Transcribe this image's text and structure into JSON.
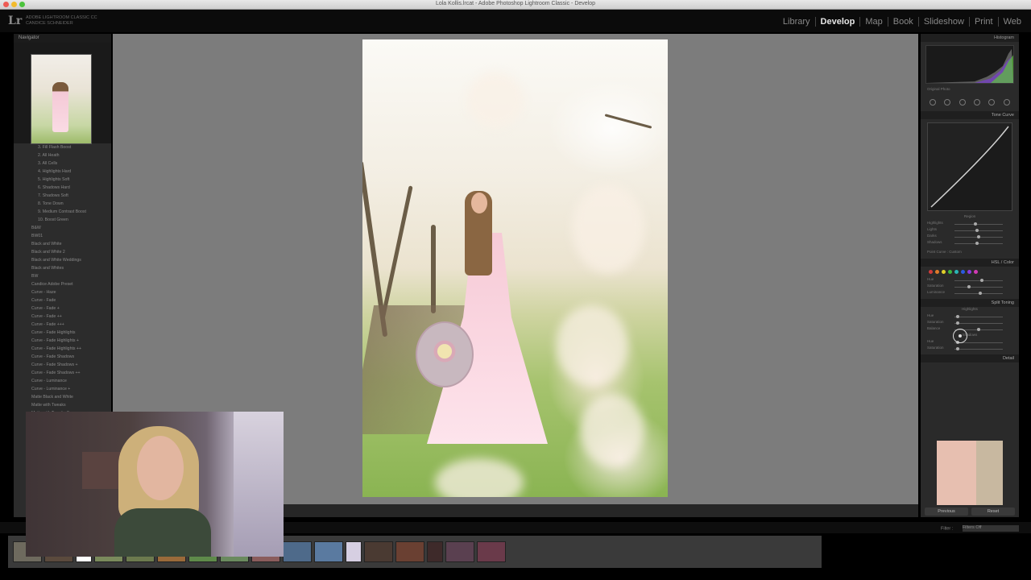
{
  "window": {
    "title": "Lola Kollis.lrcat - Adobe Photoshop Lightroom Classic - Develop"
  },
  "header": {
    "logo": "Lr",
    "brand_line1": "ADOBE LIGHTROOM CLASSIC CC",
    "brand_line2": "CANDICE SCHNEIDER",
    "modules": [
      "Library",
      "Develop",
      "Map",
      "Book",
      "Slideshow",
      "Print",
      "Web"
    ],
    "active_module": "Develop"
  },
  "left_panel": {
    "navigator_title": "Navigator",
    "presets": [
      "3. Fill Flash Boost",
      "2. All Heath",
      "3. All Cells",
      "4. Highlights Hard",
      "5. Highlights Soft",
      "6. Shadows Hard",
      "7. Shadows Soft",
      "8. Tone Down",
      "9. Medium Contrast Boost",
      "10. Boost Green",
      "B&W",
      "BW01",
      "Black and White",
      "Black and White 2",
      "Black and White Weddings",
      "Black and Whites",
      "BW",
      "Candice Adobe Preset",
      "Curve - Haze",
      "Curve - Fade",
      "Curve - Fade +",
      "Curve - Fade ++",
      "Curve - Fade +++",
      "Curve - Fade Highlights",
      "Curve - Fade Highlights +",
      "Curve - Fade Highlights ++",
      "Curve - Fade Shadows",
      "Curve - Fade Shadows +",
      "Curve - Fade Shadows ++",
      "Curve - Luminance",
      "Curve - Luminance +",
      "Matte Black and White",
      "Matte with Tweaks",
      "Matte with Tweaks 2"
    ]
  },
  "right_panel": {
    "histogram_title": "Histogram",
    "original_photo": "Original Photo",
    "tone_curve_title": "Tone Curve",
    "region_label": "Region",
    "curve_sliders": [
      "Highlights",
      "Lights",
      "Darks",
      "Shadows"
    ],
    "point_curve_label": "Point Curve :",
    "point_curve_value": "Custom",
    "hsl_title": "HSL / Color",
    "hsl_sliders": [
      "Hue",
      "Saturation",
      "Luminance"
    ],
    "split_toning_title": "Split Toning",
    "highlights_label": "Highlights",
    "balance_label": "Balance",
    "shadows_label": "Shadows",
    "hue_label": "Hue",
    "saturation_label": "Saturation",
    "detail_title": "Detail",
    "previous_button": "Previous",
    "reset_button": "Reset"
  },
  "filmstrip": {
    "filter_label": "Filter :",
    "filter_value": "Filters Off",
    "thumb_colors": [
      "#6e6a5e",
      "#5b4a3d",
      "#ffffff",
      "#7a8a5c",
      "#6c7a4e",
      "#9a6a3a",
      "#5e8a4a",
      "#6a8a5e",
      "#8a5c5c",
      "#4e6a8a",
      "#5a7aa0",
      "#d6cfe2",
      "#4a3a32",
      "#6a4032",
      "#3e2a2a",
      "#5a4050",
      "#6a3a4a"
    ]
  }
}
